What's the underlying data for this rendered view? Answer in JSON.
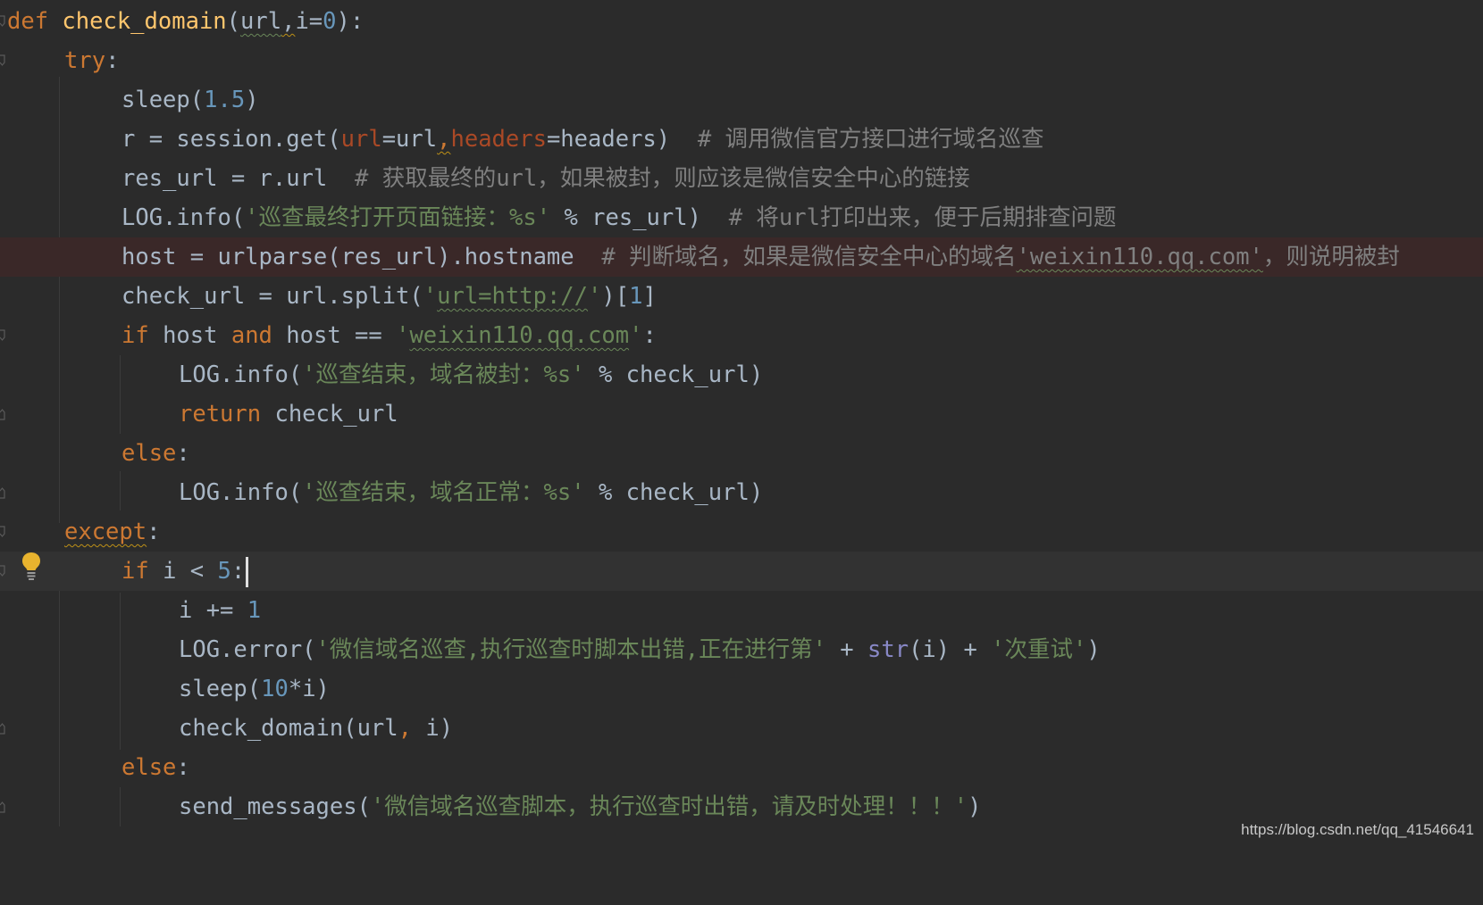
{
  "editor": {
    "language": "python",
    "theme": "darcula",
    "colors": {
      "background": "#2b2b2b",
      "keyword": "#cc7832",
      "function": "#ffc66d",
      "number": "#6897bb",
      "string": "#6a8759",
      "comment": "#808080",
      "error_line_background": "#3a2828"
    },
    "icons": [
      "lightbulb-icon",
      "fold-marker-icon"
    ],
    "caret_line": 14,
    "code": {
      "l0_def": "def",
      "l0_name": "check_domain",
      "l0_open": "(",
      "l0_url": "url",
      "l0_comma": ",",
      "l0_i": "i=",
      "l0_zero": "0",
      "l0_close": "):",
      "l1_try": "try",
      "l1_colon": ":",
      "l2_sleep": "sleep(",
      "l2_num": "1.5",
      "l2_close": ")",
      "l3_a": "r = session.get(",
      "l3_url_kw": "url",
      "l3_b": "=url",
      "l3_comma": ",",
      "l3_headers_kw": "headers",
      "l3_c": "=headers)  ",
      "l3_comment": "# 调用微信官方接口进行域名巡查",
      "l4_a": "res_url = r.url  ",
      "l4_comment": "# 获取最终的url，如果被封，则应该是微信安全中心的链接",
      "l5_a": "LOG.info(",
      "l5_str": "'巡查最终打开页面链接：%s'",
      "l5_b": " % res_url)  ",
      "l5_comment": "# 将url打印出来，便于后期排查问题",
      "l6_a": "host = urlparse(res_url).hostname  ",
      "l6_comment_a": "# 判断域名，如果是微信安全中心的域名",
      "l6_comment_b": "'weixin110.qq.com'",
      "l6_comment_c": "，则说明被封",
      "l7_a": "check_url = url.split(",
      "l7_q1": "'",
      "l7_str": "url=http://",
      "l7_q2": "'",
      "l7_b": ")[",
      "l7_num": "1",
      "l7_c": "]",
      "l8_if": "if",
      "l8_a": " host ",
      "l8_and": "and",
      "l8_b": " host == ",
      "l8_q1": "'",
      "l8_str": "weixin110.qq.com",
      "l8_q2": "'",
      "l8_c": ":",
      "l9_a": "LOG.info(",
      "l9_str": "'巡查结束，域名被封：%s'",
      "l9_b": " % check_url)",
      "l10_return": "return",
      "l10_a": " check_url",
      "l11_else": "else",
      "l11_colon": ":",
      "l12_a": "LOG.info(",
      "l12_str": "'巡查结束，域名正常：%s'",
      "l12_b": " % check_url)",
      "l13_except": "except",
      "l13_colon": ":",
      "l14_if": "if",
      "l14_a": " i < ",
      "l14_num": "5",
      "l14_b": ":",
      "l15_a": "i += ",
      "l15_num": "1",
      "l16_a": "LOG.error(",
      "l16_str1": "'微信域名巡查,执行巡查时脚本出错,正在进行第'",
      "l16_b": " + ",
      "l16_builtin": "str",
      "l16_c": "(i) + ",
      "l16_str2": "'次重试'",
      "l16_d": ")",
      "l17_a": "sleep(",
      "l17_num": "10",
      "l17_b": "*i)",
      "l18_a": "check_domain(url",
      "l18_comma": ",",
      "l18_b": " i)",
      "l19_else": "else",
      "l19_colon": ":",
      "l20_a": "send_messages(",
      "l20_str": "'微信域名巡查脚本，执行巡查时出错，请及时处理！！！'",
      "l20_b": ")"
    }
  },
  "watermark": "https://blog.csdn.net/qq_41546641"
}
